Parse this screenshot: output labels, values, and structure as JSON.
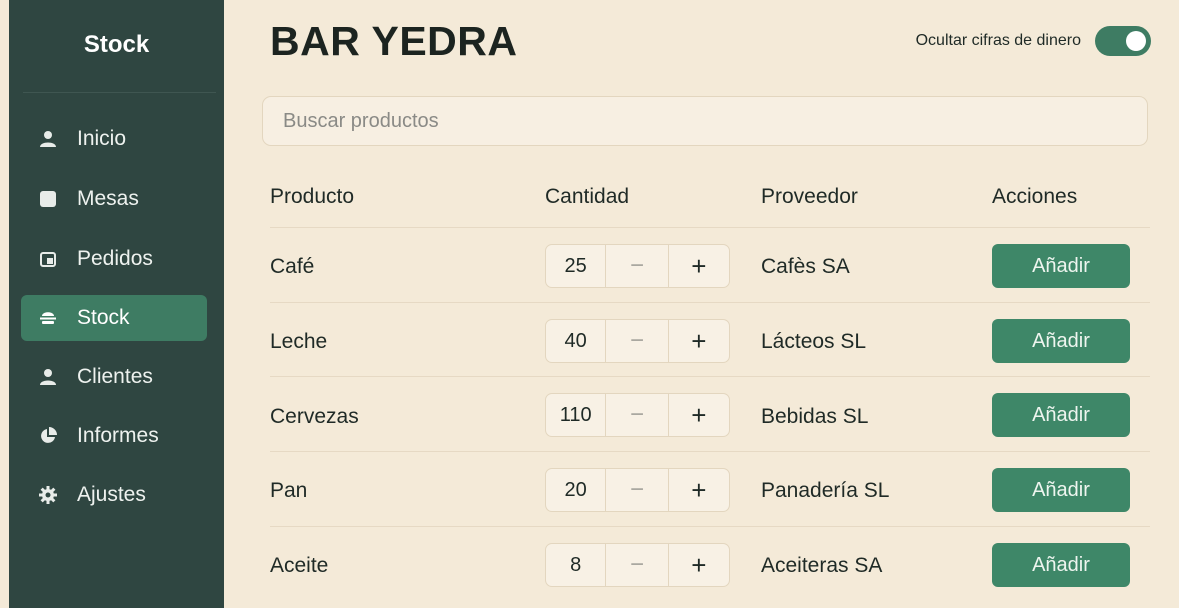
{
  "sidebar": {
    "brand": "Stock",
    "items": [
      {
        "label": "Inicio",
        "icon": "user-icon"
      },
      {
        "label": "Mesas",
        "icon": "square-icon"
      },
      {
        "label": "Pedidos",
        "icon": "orders-icon"
      },
      {
        "label": "Stock",
        "icon": "stock-icon",
        "active": true
      },
      {
        "label": "Clientes",
        "icon": "user-icon"
      },
      {
        "label": "Informes",
        "icon": "pie-chart-icon"
      },
      {
        "label": "Ajustes",
        "icon": "gear-icon"
      }
    ]
  },
  "header": {
    "title": "BAR YEDRA",
    "toggle_label": "Ocultar cifras de dinero",
    "toggle_on": true
  },
  "search": {
    "placeholder": "Buscar productos",
    "value": ""
  },
  "table": {
    "headers": [
      "Producto",
      "Cantidad",
      "Proveedor",
      "Acciones"
    ],
    "rows": [
      {
        "producto": "Café",
        "cantidad": "25",
        "proveedor": "Cafès SA",
        "accion": "Añadir"
      },
      {
        "producto": "Leche",
        "cantidad": "40",
        "proveedor": "Lácteos SL",
        "accion": "Añadir"
      },
      {
        "producto": "Cervezas",
        "cantidad": "110",
        "proveedor": "Bebidas SL",
        "accion": "Añadir"
      },
      {
        "producto": "Pan",
        "cantidad": "20",
        "proveedor": "Panadería SL",
        "accion": "Añadir"
      },
      {
        "producto": "Aceite",
        "cantidad": "8",
        "proveedor": "Aceiteras SA",
        "accion": "Añadir"
      }
    ],
    "stepper_minus": "−",
    "stepper_plus": "+"
  },
  "colors": {
    "sidebar_bg": "#2f4641",
    "accent": "#3e7c63",
    "page_bg": "#f4ead8"
  }
}
